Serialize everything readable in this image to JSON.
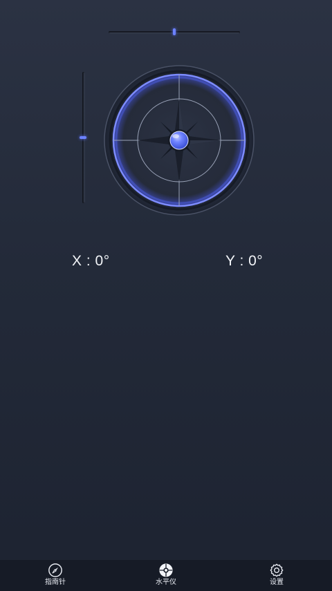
{
  "level": {
    "x_readout": "X : 0°",
    "y_readout": "Y : 0°",
    "x_bubble_fraction": 0.5,
    "y_bubble_fraction": 0.5
  },
  "nav": {
    "items": [
      {
        "label": "指南针",
        "icon": "compass-icon"
      },
      {
        "label": "水平仪",
        "icon": "level-icon"
      },
      {
        "label": "设置",
        "icon": "gear-icon"
      }
    ],
    "active": "水平仪"
  },
  "colors": {
    "accent": "#6c82ff",
    "background_top": "#2b3243",
    "background_bottom": "#1d2331",
    "nav_background": "#161b26",
    "text": "#f2f4f8"
  }
}
